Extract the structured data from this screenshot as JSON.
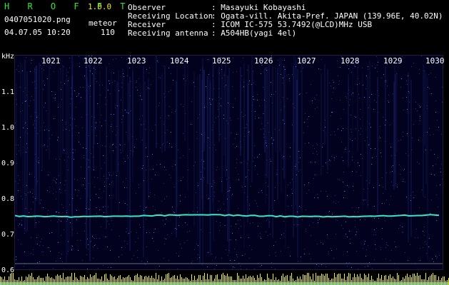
{
  "app": {
    "title": "H R O F F T",
    "version": "1.0.0"
  },
  "file": {
    "name": "0407051020.png",
    "datetime": "04.07.05 10:20"
  },
  "meteor": {
    "label": "meteor",
    "count": "110"
  },
  "info": [
    {
      "key": "Observer",
      "value": ": Masayuki Kobayashi"
    },
    {
      "key": "Receiving Location",
      "value": ": Ogata-vill. Akita-Pref. JAPAN (139.96E, 40.02N)"
    },
    {
      "key": "Receiver",
      "value": ": ICOM IC-575 53.7492(@LCD)MHz USB"
    },
    {
      "key": "Receiving antenna",
      "value": ": A504HB(yagi 4el)"
    }
  ],
  "plot": {
    "yunit": "kHz",
    "yticks": [
      "1.1",
      "1.0",
      "0.9",
      "0.8",
      "0.7",
      "0.6"
    ],
    "xticks": [
      "1021",
      "1022",
      "1023",
      "1024",
      "1025",
      "1026",
      "1027",
      "1028",
      "1029",
      "1030"
    ]
  },
  "colors": {
    "background": "#000000",
    "title": "#2ee82e",
    "version": "#e8e82e",
    "trace": "#39e6c4",
    "spectrum": "#f2f222"
  }
}
